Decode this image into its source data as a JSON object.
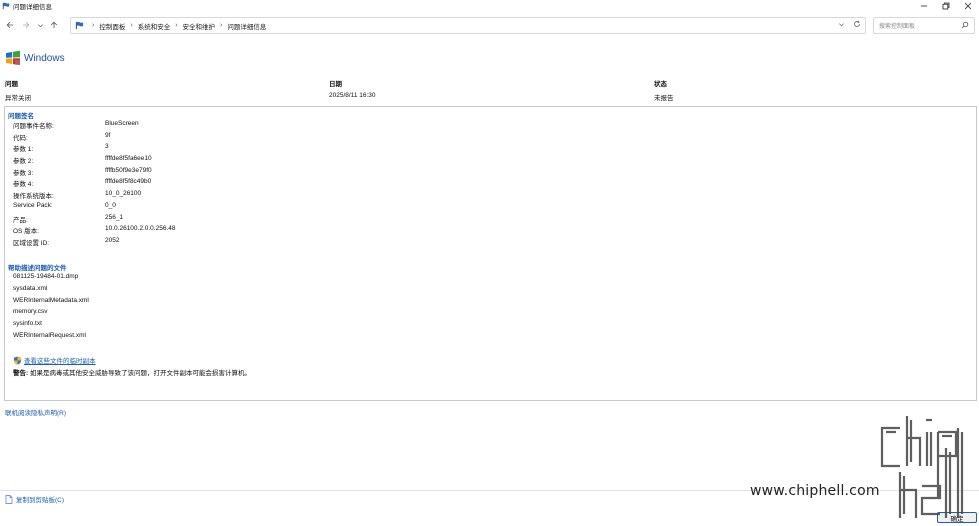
{
  "window": {
    "title": "问题详细信息",
    "controls": [
      "minimize",
      "maximize",
      "close"
    ]
  },
  "nav": {
    "breadcrumbs": [
      "控制面板",
      "系统和安全",
      "安全和维护",
      "问题详细信息"
    ],
    "search_placeholder": "搜索控制面板"
  },
  "header": {
    "product": "Windows"
  },
  "summary": {
    "problem_label": "问题",
    "problem_value": "异常关闭",
    "date_label": "日期",
    "date_value": "2025/8/11 16:30",
    "status_label": "状态",
    "status_value": "未报告"
  },
  "signature": {
    "title": "问题签名",
    "rows": [
      {
        "key": "问题事件名称:",
        "value": "BlueScreen"
      },
      {
        "key": "代码:",
        "value": "9f"
      },
      {
        "key": "参数 1:",
        "value": "3"
      },
      {
        "key": "参数 2:",
        "value": "ffffde8f5fa6ee10"
      },
      {
        "key": "参数 3:",
        "value": "ffffb50f9e3e79f0"
      },
      {
        "key": "参数 4:",
        "value": "ffffde8f5f8c49b0"
      },
      {
        "key": "操作系统版本:",
        "value": "10_0_26100"
      },
      {
        "key": "Service Pack:",
        "value": "0_0"
      },
      {
        "key": "产品:",
        "value": "256_1"
      },
      {
        "key": "OS 版本:",
        "value": "10.0.26100.2.0.0.256.48"
      },
      {
        "key": "区域设置 ID:",
        "value": "2052"
      }
    ]
  },
  "files": {
    "title": "帮助描述问题的文件",
    "items": [
      "081125-19484-01.dmp",
      "sysdata.xml",
      "WERInternalMetadata.xml",
      "memory.csv",
      "sysinfo.txt",
      "WERInternalRequest.xml"
    ]
  },
  "temp_copy_link": "查看这些文件的临时副本",
  "warning": {
    "prefix": "警告:",
    "text": " 如果是病毒或其他安全威胁导致了该问题，打开文件副本可能会损害计算机。"
  },
  "privacy_link": "联机阅读隐私声明(R)",
  "copy_clipboard_link": "复制到剪贴板(C)",
  "ok_button": "确定",
  "watermark": {
    "url": "www.chiphell.com"
  },
  "colors": {
    "link": "#1a5fb4",
    "header_blue": "#1e4e9a",
    "panel_border": "#c8c8c8"
  }
}
